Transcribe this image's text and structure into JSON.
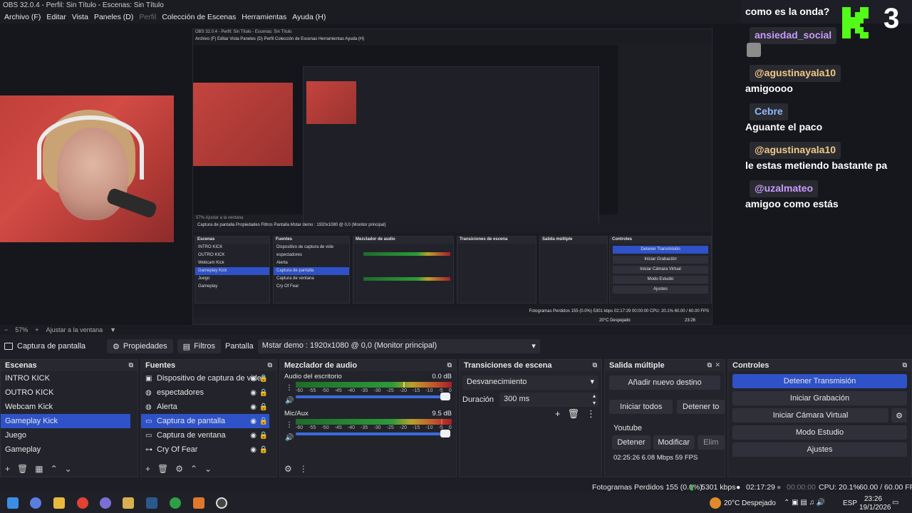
{
  "window": {
    "title": "OBS 32.0.4 - Perfil: Sin Título - Escenas: Sin Título"
  },
  "menu": [
    {
      "label": "Archivo (F)",
      "disabled": false
    },
    {
      "label": "Editar",
      "disabled": false
    },
    {
      "label": "Vista",
      "disabled": false
    },
    {
      "label": "Paneles (D)",
      "disabled": false
    },
    {
      "label": "Perfil",
      "disabled": true
    },
    {
      "label": "Colección de Escenas",
      "disabled": false
    },
    {
      "label": "Herramientas",
      "disabled": false
    },
    {
      "label": "Ayuda (H)",
      "disabled": false
    }
  ],
  "chat": {
    "top_line": "como es la onda?",
    "kick_count": "3",
    "messages": [
      {
        "user": "ansiedad_social",
        "user_color": "#c79bff",
        "text": ""
      },
      {
        "user": "@agustinayala10",
        "user_color": "#f0c987",
        "text": "amigoooo"
      },
      {
        "user": "Cebre",
        "user_color": "#8fb8ff",
        "text": "Aguante el paco"
      },
      {
        "user": "@agustinayala10",
        "user_color": "#f0c987",
        "text": "le estas metiendo bastante pa"
      },
      {
        "user": "@uzalmateo",
        "user_color": "#c79bff",
        "text": "amigoo como estás"
      }
    ],
    "kick_color": "#53fc18"
  },
  "nested": {
    "title": "OBS 32.0.4 - Perfil: Sin Título - Escenas: Sin Título",
    "menu": "Archivo (F)   Editar   Vista   Paneles (D)   Perfil   Colección de Escenas   Herramientas   Ayuda (H)",
    "zoom": "57%   Ajustar a la ventana",
    "srcbar": "Captura de pantalla      Propiedades      Filtros      Pantalla      Mstar demo : 1920x1080 @ 0,0 (Monitor principal)",
    "scenes_title": "Escenas",
    "scenes": [
      "INTRO KICK",
      "OUTRO KICK",
      "Webcam Kick",
      "Gameplay Kick",
      "Juego",
      "Gameplay"
    ],
    "sources_title": "Fuentes",
    "sources": [
      "Dispositivo de captura de vide",
      "espectadores",
      "Alerta",
      "Captura de pantalla",
      "Captura de ventana",
      "Cry Of Fear"
    ],
    "mixer_title": "Mezclador de audio",
    "trans_title": "Transiciones de escena",
    "multi_title": "Salida múltiple",
    "controls_title": "Controles",
    "controls": [
      "Detener Transmisión",
      "Iniciar Grabación",
      "Iniciar Cámara Virtual",
      "Modo Estudio",
      "Ajustes"
    ],
    "status": "Fotogramas Perdidos 155 (0.0%)      5301 kbps      02:17:29      00:00:00      CPU: 20.1%      60.00 / 60.00 FPS",
    "weather": "20°C  Despejado",
    "clock": "23:26"
  },
  "zoom": {
    "value": "57%",
    "fit_label": "Ajustar a la ventana"
  },
  "source_toolbar": {
    "source_name": "Captura de pantalla",
    "properties": "Propiedades",
    "filters": "Filtros",
    "display_label": "Pantalla",
    "display_value": "Mstar demo : 1920x1080 @ 0,0 (Monitor principal)"
  },
  "scenes": {
    "title": "Escenas",
    "items": [
      "INTRO KICK",
      "OUTRO KICK",
      "Webcam Kick",
      "Gameplay Kick",
      "Juego",
      "Gameplay"
    ],
    "selected": 3
  },
  "sources": {
    "title": "Fuentes",
    "items": [
      {
        "label": "Dispositivo de captura de videc",
        "icon": "camera-icon"
      },
      {
        "label": "espectadores",
        "icon": "browser-icon"
      },
      {
        "label": "Alerta",
        "icon": "browser-icon"
      },
      {
        "label": "Captura de pantalla",
        "icon": "monitor-icon"
      },
      {
        "label": "Captura de ventana",
        "icon": "window-icon"
      },
      {
        "label": "Cry Of Fear",
        "icon": "gamepad-icon"
      }
    ],
    "selected": 3
  },
  "mixer": {
    "title": "Mezclador de audio",
    "tracks": [
      {
        "name": "Audio del escritorio",
        "db": "0.0 dB",
        "peak": 0.69
      },
      {
        "name": "Mic/Aux",
        "db": "9.5 dB",
        "peak": 0.93
      }
    ],
    "scale": [
      "-60",
      "-55",
      "-50",
      "-45",
      "-40",
      "-35",
      "-30",
      "-25",
      "-20",
      "-15",
      "-10",
      "-5",
      "0"
    ]
  },
  "transitions": {
    "title": "Transiciones de escena",
    "type": "Desvanecimiento",
    "duration_label": "Duración",
    "duration_value": "300 ms"
  },
  "multi_output": {
    "title": "Salida múltiple",
    "add_button": "Añadir nuevo destino",
    "start_all": "Iniciar todos",
    "stop_all": "Detener to",
    "platform": "Youtube",
    "stop": "Detener",
    "modify": "Modificar",
    "delete": "Elim",
    "stats": "02:25:26  6.08 Mbps  59 FPS"
  },
  "controls": {
    "title": "Controles",
    "stop_stream": "Detener Transmisión",
    "start_rec": "Iniciar Grabación",
    "start_vcam": "Iniciar Cámara Virtual",
    "studio": "Modo Estudio",
    "settings": "Ajustes"
  },
  "status": {
    "dropped": "Fotogramas Perdidos 155 (0.0%)",
    "bitrate": "5301 kbps",
    "stream_time": "02:17:29",
    "rec_time": "00:00:00",
    "cpu": "CPU: 20.1%",
    "fps": "60.00 / 60.00 FPS"
  },
  "taskbar": {
    "weather": "20°C",
    "weather_desc": "Despejado",
    "lang": "ESP",
    "time": "23:26",
    "date": "19/1/2026"
  },
  "colors": {
    "accent": "#2f52c8",
    "kick_green": "#53fc18"
  }
}
